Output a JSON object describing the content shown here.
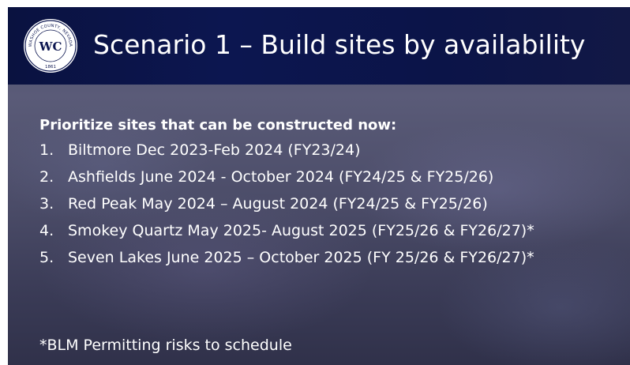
{
  "header": {
    "title": "Scenario 1 – Build sites by availability",
    "seal": {
      "arc_text": "WASHOE COUNTY, NEVADA",
      "monogram": "WC",
      "year": "1861"
    }
  },
  "body": {
    "heading": "Prioritize sites that can be constructed now:",
    "items": [
      {
        "number": "1.",
        "text": "Biltmore Dec 2023-Feb 2024 (FY23/24)"
      },
      {
        "number": "2.",
        "text": "Ashfields June 2024 - October 2024 (FY24/25 & FY25/26)"
      },
      {
        "number": "3.",
        "text": "Red Peak May 2024 – August 2024 (FY24/25 & FY25/26)"
      },
      {
        "number": "4.",
        "text": "Smokey Quartz May 2025- August 2025 (FY25/26 & FY26/27)*"
      },
      {
        "number": "5.",
        "text": "Seven Lakes June 2025 – October 2025 (FY 25/26 & FY26/27)*"
      }
    ],
    "footnote": "*BLM Permitting risks to schedule"
  },
  "colors": {
    "header_band": "#0c1650",
    "text": "#ffffff"
  }
}
